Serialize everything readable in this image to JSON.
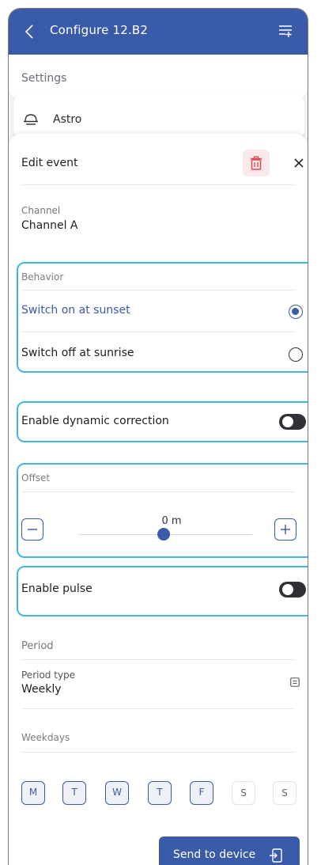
{
  "header": {
    "title": "Configure 12.B2"
  },
  "settings": {
    "label": "Settings"
  },
  "astro": {
    "label": "Astro"
  },
  "edit_event": {
    "title": "Edit event"
  },
  "channel": {
    "label": "Channel",
    "value": "Channel A"
  },
  "behavior": {
    "label": "Behavior",
    "options": [
      {
        "label": "Switch on at sunset",
        "selected": true
      },
      {
        "label": "Switch off at sunrise",
        "selected": false
      }
    ]
  },
  "dynamic_correction": {
    "label": "Enable dynamic correction",
    "enabled": false
  },
  "offset": {
    "label": "Offset",
    "value": "0 m",
    "level": 0.5
  },
  "pulse": {
    "label": "Enable pulse",
    "enabled": false
  },
  "period": {
    "label": "Period",
    "type_label": "Period type",
    "type_value": "Weekly"
  },
  "weekdays": {
    "label": "Weekdays",
    "days": [
      {
        "label": "M",
        "active": true
      },
      {
        "label": "T",
        "active": true
      },
      {
        "label": "W",
        "active": true
      },
      {
        "label": "T",
        "active": true
      },
      {
        "label": "F",
        "active": true
      },
      {
        "label": "S",
        "active": false
      },
      {
        "label": "S",
        "active": false
      }
    ]
  },
  "send": {
    "label": "Send to device"
  },
  "colors": {
    "primary": "#3a5ba8",
    "highlight": "#3fb6e6",
    "danger": "#e0454f",
    "toggle_off": "#2f3136"
  },
  "icons": [
    "chevron-left-icon",
    "menu-add-icon",
    "bell-icon",
    "trash-icon",
    "close-icon",
    "minus-icon",
    "plus-icon",
    "list-icon",
    "export-icon"
  ]
}
